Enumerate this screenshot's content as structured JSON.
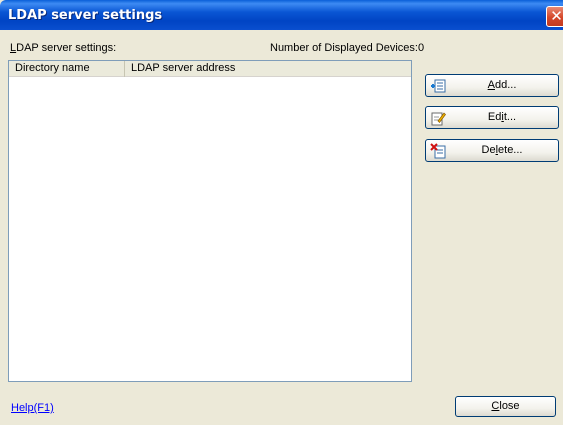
{
  "window": {
    "title": "LDAP server settings",
    "close_glyph": "✕"
  },
  "list_caption": {
    "hotkey": "L",
    "rest": "DAP server settings:"
  },
  "device_count": {
    "label": "Number of Displayed Devices:",
    "value": "0"
  },
  "table": {
    "columns": [
      "Directory name",
      "LDAP server address"
    ],
    "rows": []
  },
  "buttons": {
    "add": {
      "pre": "",
      "hotkey": "A",
      "post": "dd...",
      "icon": "add-icon"
    },
    "edit": {
      "pre": "Ed",
      "hotkey": "i",
      "post": "t...",
      "icon": "edit-icon"
    },
    "delete": {
      "pre": "De",
      "hotkey": "l",
      "post": "ete...",
      "icon": "delete-icon"
    },
    "close": {
      "pre": "",
      "hotkey": "C",
      "post": "lose"
    }
  },
  "help": {
    "label": "Help(F1)"
  },
  "colors": {
    "titlebar": "#0a56d4",
    "link": "#0000ff",
    "dialog_bg": "#ece9d8"
  }
}
